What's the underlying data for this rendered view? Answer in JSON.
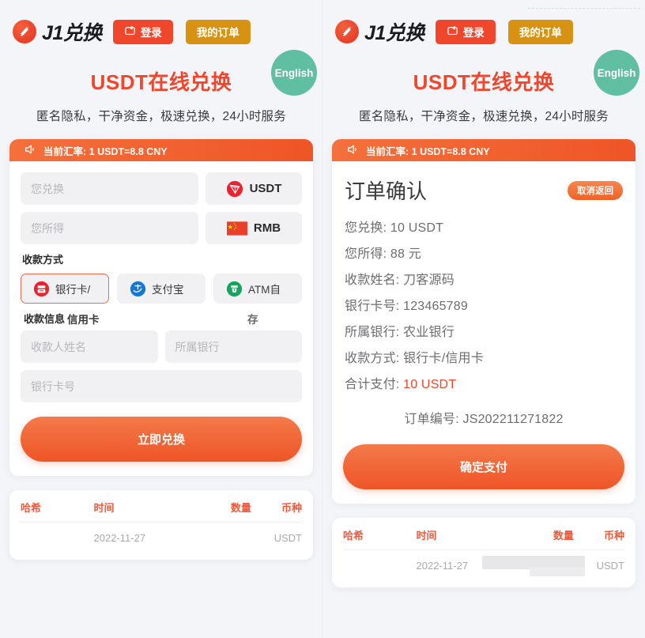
{
  "header": {
    "brand_name": "J1兑换",
    "brand_logo_icon": "j1-swirl-logo-icon",
    "login_label": "登录",
    "login_icon": "wallet-icon",
    "orders_label": "我的订单"
  },
  "hero": {
    "title": "USDT在线兑换",
    "subtitle": "匿名隐私，干净资金，极速兑换，24小时服务",
    "english_badge": "English"
  },
  "rate_bar": {
    "icon": "megaphone-icon",
    "prefix": "当前汇率: ",
    "value": "1 USDT=8.8 CNY"
  },
  "exchange_form": {
    "pay_placeholder": "您兑换",
    "receive_placeholder": "您所得",
    "pay_coin": "USDT",
    "pay_coin_icon": "tron-usdt-icon",
    "receive_coin": "RMB",
    "receive_coin_icon": "china-flag-icon",
    "method_label": "收款方式",
    "methods": [
      {
        "label": "银行卡/",
        "overflow": "信用卡",
        "icon": "bank-card-icon",
        "selected": true
      },
      {
        "label": "支付宝",
        "overflow": "",
        "icon": "alipay-icon",
        "selected": false
      },
      {
        "label": "ATM自",
        "overflow": "存",
        "icon": "atm-icon",
        "selected": false
      }
    ],
    "info_label": "收款信息",
    "name_placeholder": "收款人姓名",
    "bank_placeholder": "所属银行",
    "card_placeholder": "银行卡号",
    "submit_label": "立即兑换"
  },
  "order_confirm": {
    "title": "订单确认",
    "cancel_label": "取消返回",
    "lines": [
      {
        "label": "您兑换: ",
        "value": "10 USDT",
        "highlight": false
      },
      {
        "label": "您所得: ",
        "value": "88 元",
        "highlight": false
      },
      {
        "label": "收款姓名: ",
        "value": "刀客源码",
        "highlight": false
      },
      {
        "label": "银行卡号: ",
        "value": "123465789",
        "highlight": false
      },
      {
        "label": "所属银行: ",
        "value": "农业银行",
        "highlight": false
      },
      {
        "label": "收款方式: ",
        "value": "银行卡/信用卡",
        "highlight": false
      },
      {
        "label": "合计支付: ",
        "value": "10 USDT",
        "highlight": true
      }
    ],
    "order_no_label": "订单编号: ",
    "order_no_value": "JS202211271822",
    "confirm_label": "确定支付"
  },
  "records_table": {
    "columns": [
      "哈希",
      "时间",
      "数量",
      "币种"
    ],
    "rows": [
      {
        "hash": "",
        "time": "2022-11-27",
        "amount": "",
        "coin": "USDT"
      }
    ]
  },
  "colors": {
    "accent_orange": "#f0462c",
    "gold": "#d79211",
    "green_badge": "#5fbfa0",
    "page_bg": "#f4f5f8"
  }
}
